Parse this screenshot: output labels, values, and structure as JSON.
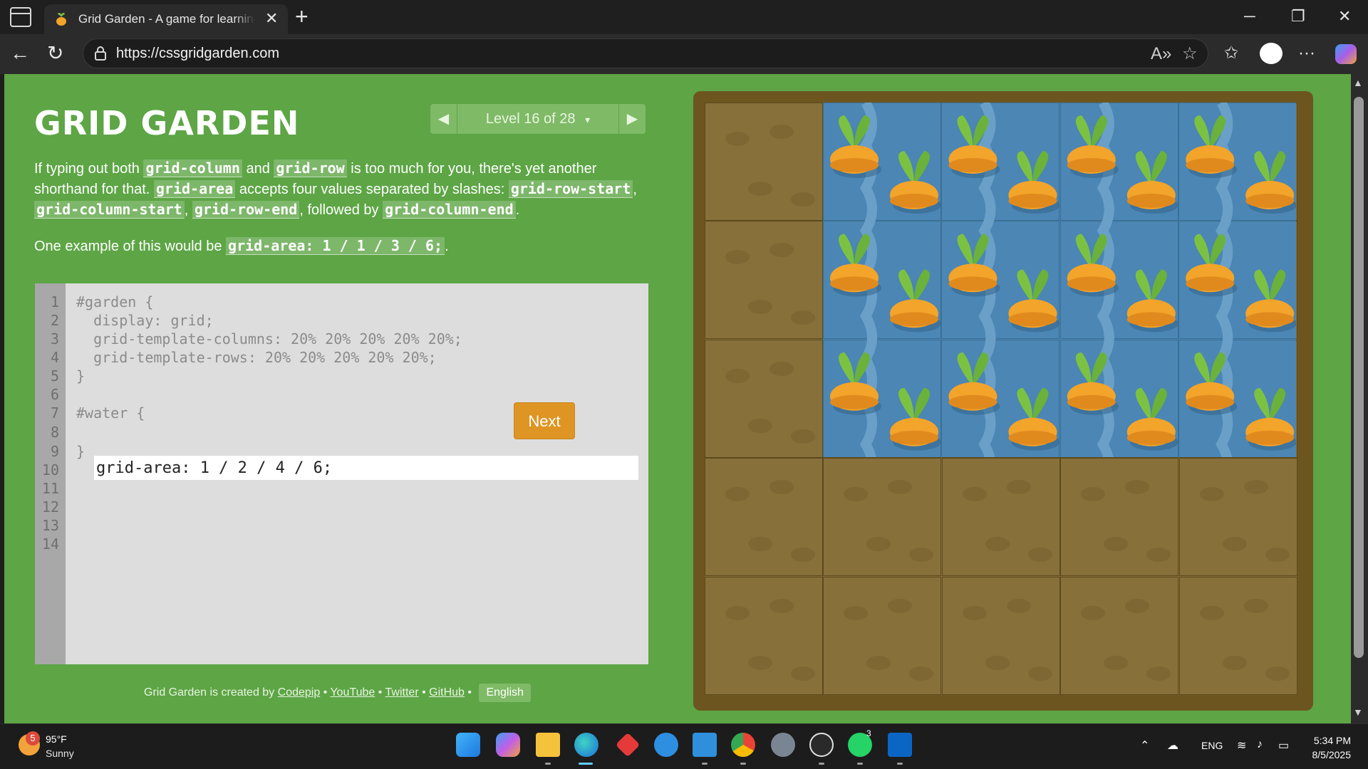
{
  "browser": {
    "tab_title": "Grid Garden - A game for learning CSS grid",
    "tab_close": "✕",
    "new_tab": "+",
    "url": "https://cssgridgarden.com",
    "minimize": "─",
    "restore": "❐",
    "close": "✕"
  },
  "game": {
    "title": "GRID GARDEN",
    "level_label": "Level 16 of 28",
    "level_dropdown": "▾",
    "prev_arrow": "◀",
    "next_arrow": "▶",
    "instructions": {
      "p1_t1": "If typing out both ",
      "p1_c1": "grid-column",
      "p1_t2": " and ",
      "p1_c2": "grid-row",
      "p1_t3": " is too much for you, there's yet another shorthand for that. ",
      "p1_c3": "grid-area",
      "p1_t4": " accepts four values separated by slashes: ",
      "p1_c4": "grid-row-start",
      "p1_t5": ", ",
      "p1_c5": "grid-column-start",
      "p1_t6": ", ",
      "p1_c6": "grid-row-end",
      "p1_t7": ", followed by ",
      "p1_c7": "grid-column-end",
      "p1_t8": ".",
      "p2_t1": "One example of this would be ",
      "p2_c1": "grid-area: 1 / 1 / 3 / 6;",
      "p2_t2": "."
    },
    "editor": {
      "line_numbers": [
        "1",
        "2",
        "3",
        "4",
        "5",
        "6",
        "7",
        "8",
        "9",
        "10",
        "11",
        "12",
        "13",
        "14"
      ],
      "lines": {
        "l1": "#garden {",
        "l2": "  display: grid;",
        "l3": "  grid-template-columns: 20% 20% 20% 20% 20%;",
        "l4": "  grid-template-rows: 20% 20% 20% 20% 20%;",
        "l5": "}",
        "l7": "#water {",
        "l9": "}"
      },
      "answer_value": "grid-area: 1 / 2 / 4 / 6;"
    },
    "next_button": "Next",
    "footer": {
      "prefix": "Grid Garden is created by ",
      "codepip": "Codepip",
      "sep": " • ",
      "youtube": "YouTube",
      "twitter": "Twitter",
      "github": "GitHub",
      "language": "English"
    },
    "colors": {
      "page_green": "#5da545",
      "water_blue": "#4b86b4",
      "soil_brown": "#87703a",
      "next_orange": "#de9523"
    }
  },
  "taskbar": {
    "weather_badge": "5",
    "temperature": "95°F",
    "condition": "Sunny",
    "language": "ENG",
    "time": "5:34 PM",
    "date": "8/5/2025",
    "whatsapp_badge": "3",
    "apps": [
      "windows-start-icon",
      "copilot-icon",
      "file-explorer-icon",
      "edge-icon",
      "app-red-diamond-icon",
      "help-icon",
      "vscode-icon",
      "chrome-icon",
      "settings-icon",
      "chatgpt-icon",
      "whatsapp-icon",
      "linkedin-icon"
    ]
  }
}
